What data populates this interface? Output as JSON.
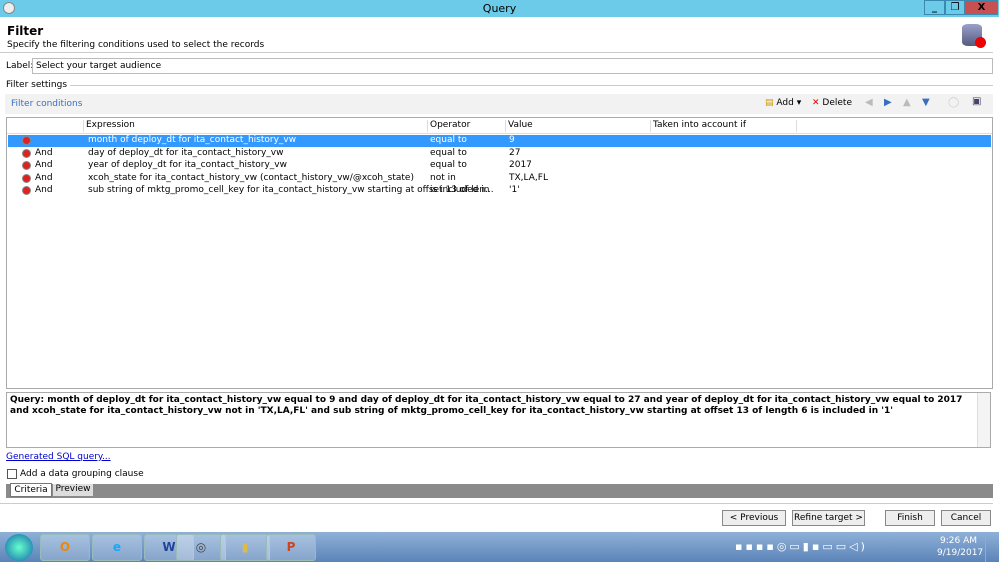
{
  "window": {
    "title": "Query",
    "min": "_",
    "restore": "❐",
    "close": "X"
  },
  "header": {
    "title": "Filter",
    "subtitle": "Specify the filtering conditions used to select the records"
  },
  "label": {
    "caption": "Label:",
    "value": "Select your target audience"
  },
  "filter_settings": "Filter settings",
  "filter_conditions": "Filter conditions",
  "toolbar": {
    "add": "Add",
    "delete": "Delete"
  },
  "table": {
    "columns": [
      "Expression",
      "Operator",
      "Value",
      "Taken into account if"
    ],
    "rows": [
      {
        "conj": "",
        "expression": "month of deploy_dt for ita_contact_history_vw",
        "operator": "equal to",
        "value": "9"
      },
      {
        "conj": "And",
        "expression": "day of deploy_dt for ita_contact_history_vw",
        "operator": "equal to",
        "value": "27"
      },
      {
        "conj": "And",
        "expression": "year of deploy_dt for ita_contact_history_vw",
        "operator": "equal to",
        "value": "2017"
      },
      {
        "conj": "And",
        "expression": "xcoh_state for ita_contact_history_vw (contact_history_vw/@xcoh_state)",
        "operator": "not in",
        "value": "TX,LA,FL"
      },
      {
        "conj": "And",
        "expression": "sub string of mktg_promo_cell_key for ita_contact_history_vw starting at offset 13 of len...",
        "operator": "is included in",
        "value": "'1'"
      }
    ]
  },
  "query": "Query: month of deploy_dt for ita_contact_history_vw equal to 9 and day of deploy_dt for ita_contact_history_vw equal to 27 and year of deploy_dt for ita_contact_history_vw equal to 2017 and xcoh_state for ita_contact_history_vw not in 'TX,LA,FL' and sub string of mktg_promo_cell_key for ita_contact_history_vw starting at offset 13 of length 6 is included in '1'",
  "sql_link": "Generated SQL query...",
  "grouping": "Add a data grouping clause",
  "tabs": [
    "Criteria",
    "Preview"
  ],
  "buttons": {
    "previous": "< Previous",
    "refine": "Refine target >",
    "finish": "Finish",
    "cancel": "Cancel"
  },
  "taskbar": {
    "apps": [
      "O",
      "e",
      "W",
      "◎",
      "▮",
      "P"
    ],
    "time": "9:26 AM",
    "date": "9/19/2017"
  }
}
